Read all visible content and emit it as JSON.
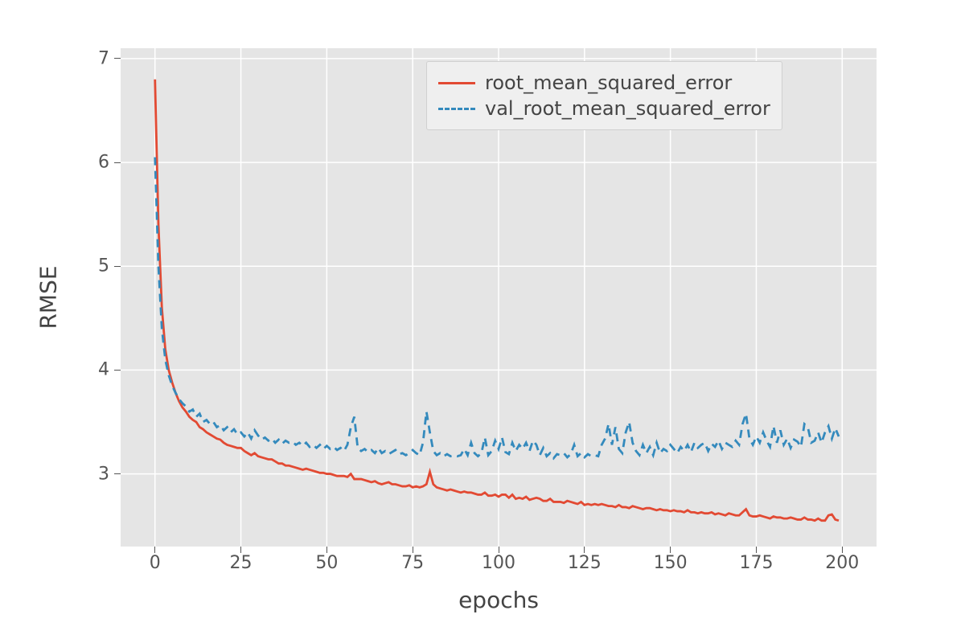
{
  "chart_data": {
    "type": "line",
    "title": "",
    "xlabel": "epochs",
    "ylabel": "RMSE",
    "xlim": [
      -10,
      210
    ],
    "ylim": [
      2.3,
      7.1
    ],
    "x_ticks": [
      0,
      25,
      50,
      75,
      100,
      125,
      150,
      175,
      200
    ],
    "y_ticks": [
      3,
      4,
      5,
      6,
      7
    ],
    "legend_position": "upper center-right",
    "grid": true,
    "colors": {
      "train": "#e24a33",
      "val": "#348abd"
    },
    "x": [
      0,
      1,
      2,
      3,
      4,
      5,
      6,
      7,
      8,
      9,
      10,
      11,
      12,
      13,
      14,
      15,
      16,
      17,
      18,
      19,
      20,
      21,
      22,
      23,
      24,
      25,
      26,
      27,
      28,
      29,
      30,
      31,
      32,
      33,
      34,
      35,
      36,
      37,
      38,
      39,
      40,
      41,
      42,
      43,
      44,
      45,
      46,
      47,
      48,
      49,
      50,
      51,
      52,
      53,
      54,
      55,
      56,
      57,
      58,
      59,
      60,
      61,
      62,
      63,
      64,
      65,
      66,
      67,
      68,
      69,
      70,
      71,
      72,
      73,
      74,
      75,
      76,
      77,
      78,
      79,
      80,
      81,
      82,
      83,
      84,
      85,
      86,
      87,
      88,
      89,
      90,
      91,
      92,
      93,
      94,
      95,
      96,
      97,
      98,
      99,
      100,
      101,
      102,
      103,
      104,
      105,
      106,
      107,
      108,
      109,
      110,
      111,
      112,
      113,
      114,
      115,
      116,
      117,
      118,
      119,
      120,
      121,
      122,
      123,
      124,
      125,
      126,
      127,
      128,
      129,
      130,
      131,
      132,
      133,
      134,
      135,
      136,
      137,
      138,
      139,
      140,
      141,
      142,
      143,
      144,
      145,
      146,
      147,
      148,
      149,
      150,
      151,
      152,
      153,
      154,
      155,
      156,
      157,
      158,
      159,
      160,
      161,
      162,
      163,
      164,
      165,
      166,
      167,
      168,
      169,
      170,
      171,
      172,
      173,
      174,
      175,
      176,
      177,
      178,
      179,
      180,
      181,
      182,
      183,
      184,
      185,
      186,
      187,
      188,
      189,
      190,
      191,
      192,
      193,
      194,
      195,
      196,
      197,
      198,
      199
    ],
    "series": [
      {
        "name": "root_mean_squared_error",
        "style": "solid",
        "color": "#e24a33",
        "values": [
          6.8,
          5.4,
          4.6,
          4.2,
          4.0,
          3.88,
          3.78,
          3.7,
          3.64,
          3.6,
          3.55,
          3.52,
          3.5,
          3.45,
          3.43,
          3.4,
          3.38,
          3.36,
          3.34,
          3.33,
          3.3,
          3.28,
          3.27,
          3.26,
          3.25,
          3.25,
          3.22,
          3.2,
          3.18,
          3.2,
          3.17,
          3.16,
          3.15,
          3.14,
          3.14,
          3.12,
          3.1,
          3.1,
          3.08,
          3.08,
          3.07,
          3.06,
          3.05,
          3.04,
          3.05,
          3.04,
          3.03,
          3.02,
          3.01,
          3.01,
          3.0,
          3.0,
          2.99,
          2.98,
          2.98,
          2.98,
          2.97,
          3.0,
          2.95,
          2.95,
          2.95,
          2.94,
          2.93,
          2.92,
          2.93,
          2.91,
          2.9,
          2.91,
          2.92,
          2.9,
          2.9,
          2.89,
          2.88,
          2.88,
          2.89,
          2.87,
          2.88,
          2.87,
          2.88,
          2.9,
          3.02,
          2.9,
          2.87,
          2.86,
          2.85,
          2.84,
          2.85,
          2.84,
          2.83,
          2.82,
          2.83,
          2.82,
          2.82,
          2.81,
          2.8,
          2.8,
          2.82,
          2.79,
          2.79,
          2.8,
          2.78,
          2.8,
          2.8,
          2.77,
          2.8,
          2.76,
          2.77,
          2.76,
          2.78,
          2.75,
          2.76,
          2.77,
          2.76,
          2.74,
          2.74,
          2.76,
          2.73,
          2.73,
          2.73,
          2.72,
          2.74,
          2.73,
          2.72,
          2.71,
          2.73,
          2.7,
          2.71,
          2.7,
          2.71,
          2.7,
          2.71,
          2.7,
          2.69,
          2.69,
          2.68,
          2.7,
          2.68,
          2.68,
          2.67,
          2.69,
          2.68,
          2.67,
          2.66,
          2.67,
          2.67,
          2.66,
          2.65,
          2.66,
          2.65,
          2.65,
          2.64,
          2.65,
          2.64,
          2.64,
          2.63,
          2.65,
          2.63,
          2.63,
          2.62,
          2.63,
          2.62,
          2.62,
          2.63,
          2.61,
          2.62,
          2.61,
          2.6,
          2.62,
          2.61,
          2.6,
          2.6,
          2.63,
          2.66,
          2.6,
          2.59,
          2.59,
          2.6,
          2.59,
          2.58,
          2.57,
          2.59,
          2.58,
          2.58,
          2.57,
          2.57,
          2.58,
          2.57,
          2.56,
          2.56,
          2.58,
          2.56,
          2.56,
          2.55,
          2.57,
          2.55,
          2.55,
          2.6,
          2.61,
          2.56,
          2.55
        ]
      },
      {
        "name": "val_root_mean_squared_error",
        "style": "dashed",
        "color": "#348abd",
        "values": [
          6.05,
          5.0,
          4.4,
          4.1,
          3.95,
          3.85,
          3.78,
          3.72,
          3.68,
          3.65,
          3.6,
          3.62,
          3.55,
          3.58,
          3.5,
          3.52,
          3.48,
          3.5,
          3.45,
          3.47,
          3.42,
          3.45,
          3.4,
          3.43,
          3.38,
          3.4,
          3.36,
          3.4,
          3.34,
          3.42,
          3.37,
          3.33,
          3.35,
          3.32,
          3.34,
          3.3,
          3.33,
          3.29,
          3.32,
          3.3,
          3.31,
          3.28,
          3.3,
          3.27,
          3.3,
          3.26,
          3.28,
          3.25,
          3.28,
          3.24,
          3.27,
          3.24,
          3.26,
          3.23,
          3.25,
          3.22,
          3.28,
          3.45,
          3.55,
          3.25,
          3.22,
          3.24,
          3.21,
          3.23,
          3.2,
          3.25,
          3.2,
          3.22,
          3.19,
          3.21,
          3.23,
          3.19,
          3.2,
          3.18,
          3.2,
          3.23,
          3.2,
          3.18,
          3.3,
          3.6,
          3.4,
          3.22,
          3.18,
          3.2,
          3.17,
          3.19,
          3.17,
          3.18,
          3.17,
          3.18,
          3.24,
          3.18,
          3.3,
          3.2,
          3.17,
          3.2,
          3.35,
          3.18,
          3.22,
          3.32,
          3.24,
          3.35,
          3.21,
          3.19,
          3.3,
          3.22,
          3.28,
          3.24,
          3.3,
          3.22,
          3.32,
          3.28,
          3.18,
          3.25,
          3.17,
          3.2,
          3.15,
          3.19,
          3.18,
          3.2,
          3.16,
          3.19,
          3.28,
          3.17,
          3.2,
          3.16,
          3.19,
          3.17,
          3.18,
          3.17,
          3.28,
          3.34,
          3.48,
          3.28,
          3.45,
          3.24,
          3.2,
          3.4,
          3.5,
          3.3,
          3.22,
          3.18,
          3.28,
          3.2,
          3.26,
          3.18,
          3.3,
          3.2,
          3.24,
          3.22,
          3.28,
          3.24,
          3.2,
          3.26,
          3.22,
          3.28,
          3.21,
          3.3,
          3.25,
          3.28,
          3.3,
          3.22,
          3.29,
          3.26,
          3.32,
          3.24,
          3.3,
          3.28,
          3.26,
          3.32,
          3.28,
          3.48,
          3.58,
          3.34,
          3.28,
          3.36,
          3.3,
          3.4,
          3.32,
          3.26,
          3.46,
          3.3,
          3.42,
          3.28,
          3.34,
          3.25,
          3.33,
          3.31,
          3.26,
          3.48,
          3.45,
          3.3,
          3.32,
          3.4,
          3.3,
          3.4,
          3.46,
          3.34,
          3.44,
          3.36
        ]
      }
    ]
  },
  "axis_labels": {
    "x": "epochs",
    "y": "RMSE"
  },
  "tick_labels": {
    "x": [
      "0",
      "25",
      "50",
      "75",
      "100",
      "125",
      "150",
      "175",
      "200"
    ],
    "y": [
      "3",
      "4",
      "5",
      "6",
      "7"
    ]
  },
  "legend": {
    "items": [
      {
        "label": "root_mean_squared_error"
      },
      {
        "label": "val_root_mean_squared_error"
      }
    ]
  }
}
